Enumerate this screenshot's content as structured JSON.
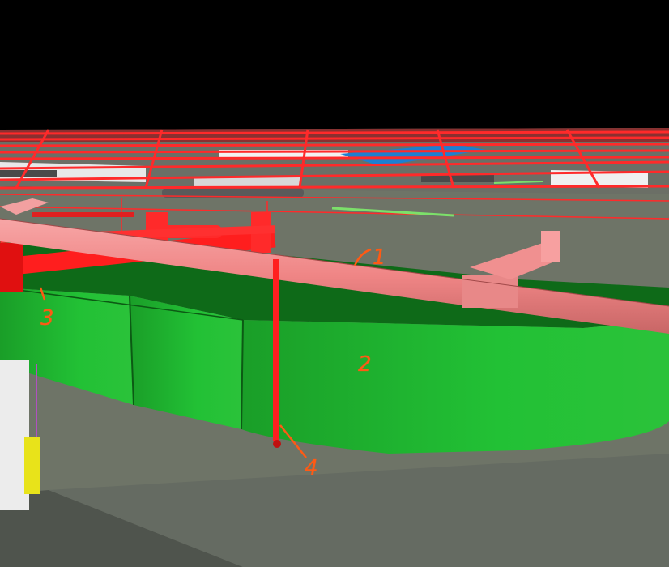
{
  "colors": {
    "sky": "#000000",
    "ceiling_pipe": "#ff2a2a",
    "main_pipe": "#f08a8a",
    "duct": "#1fb52f",
    "duct_dark": "#0e6a18",
    "wall": "#6e7467",
    "floor": "#555b54",
    "column": "#e8e8e8",
    "annotation": "#ff5a14"
  },
  "annotations": [
    {
      "label": "1",
      "target": "main-pipe"
    },
    {
      "label": "2",
      "target": "green-duct"
    },
    {
      "label": "3",
      "target": "red-pipe-assembly"
    },
    {
      "label": "4",
      "target": "vertical-drop-pipe"
    }
  ]
}
